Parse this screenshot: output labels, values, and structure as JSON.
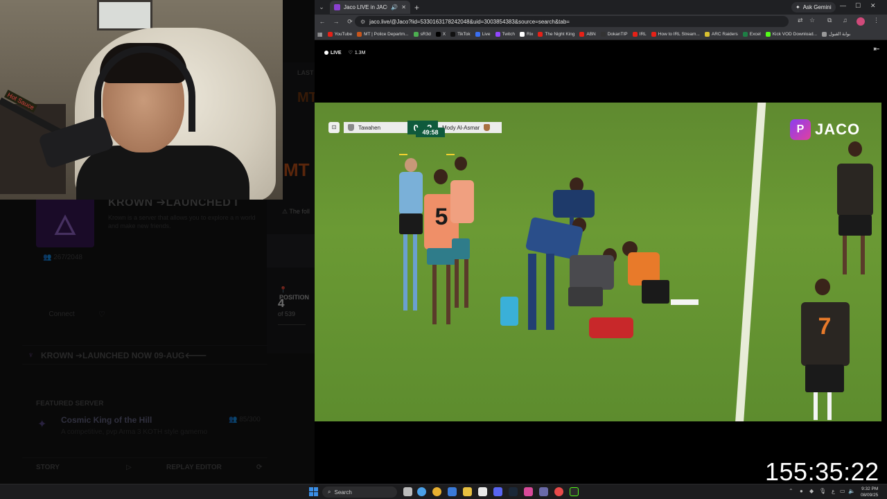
{
  "launcher": {
    "side": {
      "last_label": "LAST",
      "mt_small": "MT",
      "mt_large": "MT",
      "warning_text": "The foll",
      "position_label": "POSITION",
      "position_value": "4",
      "position_of": "of 539"
    },
    "server": {
      "title": "KROWN ➔LAUNCHED I",
      "description": "Krown is a server that allows you to explore a n world and make new friends.",
      "players": "267/2048",
      "connect_label": "Connect"
    },
    "banner_text": "KROWN ➔LAUNCHED NOW 09-AUG🡐",
    "featured": {
      "label": "FEATURED SERVER",
      "name": "Cosmic King of the Hill",
      "description": "A competitive, pvp Arma 3 KOTH style gamemo",
      "count": "85/300"
    },
    "bottom": {
      "story_label": "STORY",
      "replay_label": "REPLAY EDITOR"
    }
  },
  "webcam": {
    "mic_label": "Hot Sauce"
  },
  "browser": {
    "tab_title": "Jaco LIVE in JACO - JACO",
    "ask_gemini": "Ask Gemini",
    "url": "jaco.live/@Jaco?lid=5330163178242048&uid=3003854383&source=search&tab=",
    "bookmarks": [
      {
        "label": "YouTube",
        "color": "#e62117"
      },
      {
        "label": "MT | Police Departm...",
        "color": "#c8561c"
      },
      {
        "label": "sR3d",
        "color": "#4caf50"
      },
      {
        "label": "X",
        "color": "#000000"
      },
      {
        "label": "TikTok",
        "color": "#111111"
      },
      {
        "label": "Live",
        "color": "#3a6ff0"
      },
      {
        "label": "Twitch",
        "color": "#9146ff"
      },
      {
        "label": "Rix",
        "color": "#ffffff"
      },
      {
        "label": "The Night King",
        "color": "#e62117"
      },
      {
        "label": "ABN",
        "color": "#e62117"
      },
      {
        "label": "DokanTIP",
        "color": "#333333"
      },
      {
        "label": "IRL",
        "color": "#e62117"
      },
      {
        "label": "How to IRL Stream...",
        "color": "#e62117"
      },
      {
        "label": "ARC Raiders",
        "color": "#d8c030"
      },
      {
        "label": "Excel",
        "color": "#1e7e45"
      },
      {
        "label": "Kick VOD Download...",
        "color": "#53fc18"
      },
      {
        "label": "بوابة القبول",
        "color": "#999999"
      }
    ]
  },
  "stream": {
    "live_label": "LIVE",
    "viewers": "1.3M",
    "brand": "JACO",
    "brand_mark": "P"
  },
  "scoreboard": {
    "clock": "49:58",
    "home_team": "Tawahen",
    "home_score": "0",
    "away_score": "2",
    "away_team": "Mody Al-Asmar"
  },
  "players": {
    "bib_number": "5",
    "away_number": "7"
  },
  "overlay": {
    "timer": "155:35:22"
  },
  "taskbar": {
    "search_label": "Search",
    "time": "9:32 PM",
    "date": "08/09/25",
    "tray_lang": "ع"
  },
  "colors": {
    "jaco_brand": "#8b3df0",
    "score_green": "#0f5a3c",
    "pitch_green": "#6b9a34",
    "away_kit_orange": "#e87a2a"
  }
}
